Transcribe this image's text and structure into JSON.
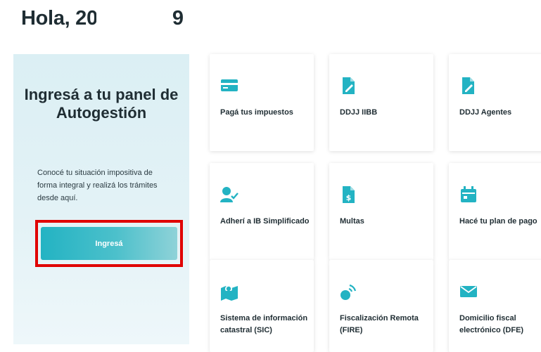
{
  "greeting": {
    "prefix": "Hola, 20",
    "suffix": "9"
  },
  "panel": {
    "title": "Ingresá a tu panel de Autogestión",
    "description": "Conocé tu situación impositiva de forma integral y realizá los trámites desde aquí.",
    "button_label": "Ingresá"
  },
  "colors": {
    "accent": "#23b3c3",
    "highlight_border": "#e00000"
  },
  "cards": [
    {
      "label": "Pagá tus impuestos",
      "icon": "credit-card-icon"
    },
    {
      "label": "DDJJ IIBB",
      "icon": "document-edit-icon"
    },
    {
      "label": "DDJJ Agentes",
      "icon": "document-edit-icon"
    },
    {
      "label": "Adherí a IB Simplificado",
      "icon": "user-check-icon"
    },
    {
      "label": "Multas",
      "icon": "document-dollar-icon"
    },
    {
      "label": "Hacé tu plan de pago",
      "icon": "calendar-icon"
    },
    {
      "label": "Sistema de información catastral (SIC)",
      "icon": "map-icon"
    },
    {
      "label": "Fiscalización Remota (FIRE)",
      "icon": "satellite-icon"
    },
    {
      "label": "Domicilio fiscal electrónico (DFE)",
      "icon": "envelope-icon"
    }
  ]
}
